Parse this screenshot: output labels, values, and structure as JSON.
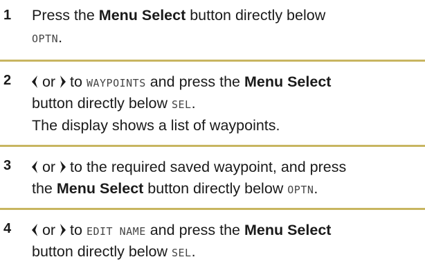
{
  "colors": {
    "divider": "#c8b560",
    "text": "#1a1a1a",
    "display_text": "#444444"
  },
  "steps": [
    {
      "number": "1",
      "line1_a": "Press the ",
      "line1_bold": "Menu Select",
      "line1_b": " button directly below",
      "line2_mono": "OPTN",
      "line2_end": "."
    },
    {
      "number": "2",
      "or_text": " or ",
      "to_text": " to ",
      "line1_mono": "WAYPOINTS",
      "line1_b": " and press the ",
      "line1_bold": "Menu Select",
      "line2_a": "button directly below ",
      "line2_mono": "SEL",
      "line2_end": ".",
      "line3": "The display shows a list of waypoints."
    },
    {
      "number": "3",
      "or_text": " or ",
      "line1_b": " to the required saved waypoint, and press",
      "line2_a": "the ",
      "line2_bold": "Menu Select",
      "line2_b": " button directly below ",
      "line2_mono": "OPTN",
      "line2_end": "."
    },
    {
      "number": "4",
      "or_text": " or ",
      "to_text": " to ",
      "line1_mono": "EDIT NAME",
      "line1_b": " and press the ",
      "line1_bold": "Menu Select",
      "line2_a": "button directly below ",
      "line2_mono": "SEL",
      "line2_end": "."
    }
  ],
  "icons": {
    "left": "left-arrow-icon",
    "right": "right-arrow-icon"
  }
}
